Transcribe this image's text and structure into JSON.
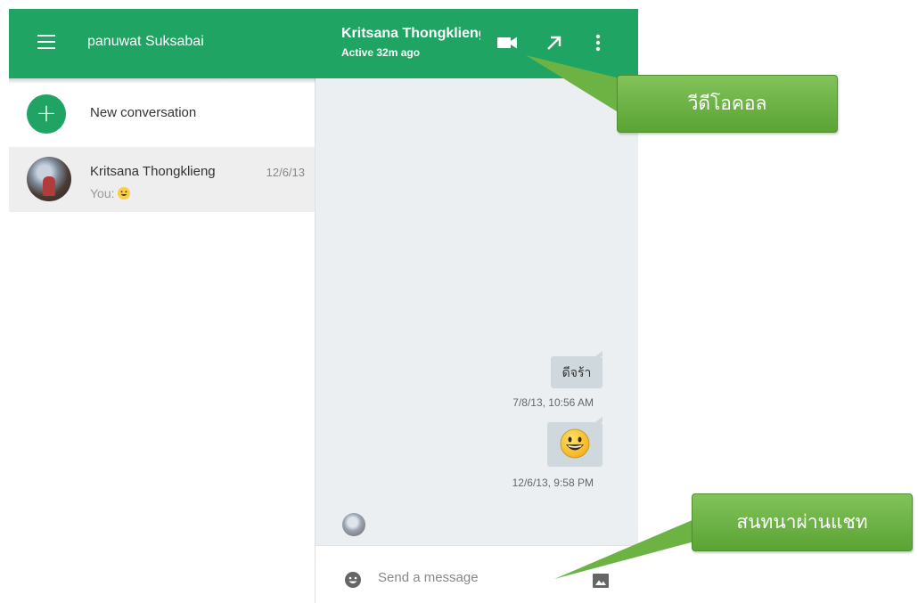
{
  "sidebar": {
    "account_name": "panuwat Suksabai",
    "new_conversation_label": "New conversation",
    "conversations": [
      {
        "name": "Kritsana Thongklieng",
        "date": "12/6/13",
        "preview": "You:"
      }
    ]
  },
  "chat": {
    "contact_name": "Kritsana Thongklieng",
    "contact_status": "Active 32m ago",
    "messages": [
      {
        "text": "ดีจร้า",
        "timestamp": "7/8/13, 10:56 AM"
      },
      {
        "text": "",
        "timestamp": "12/6/13, 9:58 PM"
      }
    ],
    "compose_placeholder": "Send a message"
  },
  "callouts": {
    "video_call": "วีดีโอคอล",
    "chat": "สนทนาผ่านแชท"
  },
  "icons": {
    "menu": "hamburger-icon",
    "new": "plus-icon",
    "video": "video-camera-icon",
    "popout": "arrow-up-right-icon",
    "more": "more-vert-icon",
    "emoji": "smiley-icon",
    "image": "image-icon"
  },
  "colors": {
    "header_green": "#1fa463",
    "callout_green": "#6cb344",
    "chat_background": "#eceff1",
    "bubble": "#cfd8dc",
    "selected_row": "#eeeeee"
  }
}
